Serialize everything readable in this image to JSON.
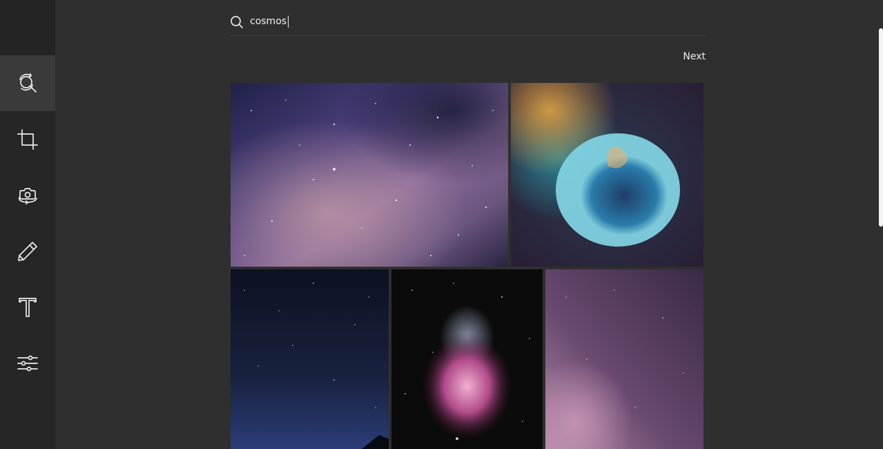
{
  "search": {
    "query": "cosmos",
    "icon": "search-icon"
  },
  "pagination": {
    "next_label": "Next"
  },
  "sidebar": {
    "tools": [
      {
        "name": "image-search",
        "icon": "search-refresh-icon",
        "active": true
      },
      {
        "name": "crop",
        "icon": "crop-icon",
        "active": false
      },
      {
        "name": "camera-rotate",
        "icon": "camera-rotate-icon",
        "active": false
      },
      {
        "name": "draw",
        "icon": "pencil-icon",
        "active": false
      },
      {
        "name": "text",
        "icon": "text-icon",
        "active": false
      },
      {
        "name": "adjust",
        "icon": "sliders-icon",
        "active": false
      }
    ]
  },
  "results": [
    {
      "name": "milky-way-purple",
      "colors": [
        "#2a2a55",
        "#6d4f8c",
        "#b48a9a"
      ]
    },
    {
      "name": "bubble-nebula",
      "colors": [
        "#1c2a3a",
        "#2a8ab0",
        "#d4a040"
      ]
    },
    {
      "name": "night-sky-blue",
      "colors": [
        "#0c1224",
        "#1f2e58",
        "#3b4a8a"
      ]
    },
    {
      "name": "orion-nebula",
      "colors": [
        "#0b0b0b",
        "#7a3a6a",
        "#d47aa8"
      ]
    },
    {
      "name": "pink-milky-way",
      "colors": [
        "#3a2840",
        "#7a5878",
        "#b48aa0"
      ]
    }
  ]
}
